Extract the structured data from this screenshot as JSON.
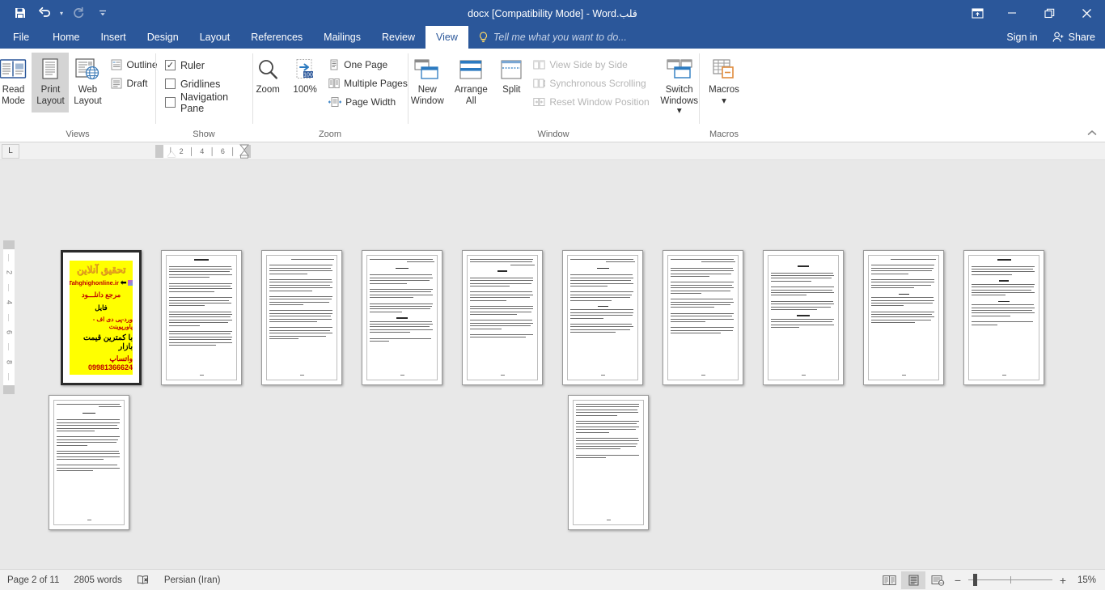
{
  "window": {
    "title": "قلب.docx [Compatibility Mode] - Word",
    "quick_access": [
      {
        "name": "save",
        "icon": "save-icon"
      },
      {
        "name": "undo",
        "icon": "undo-icon"
      },
      {
        "name": "redo",
        "icon": "redo-icon"
      },
      {
        "name": "customize-quick-access",
        "icon": "chevron-down-icon"
      }
    ],
    "controls": {
      "ribbon_display_options": "ribbon-display-options-icon",
      "minimize": "minimize-icon",
      "restore": "restore-icon",
      "close": "close-icon"
    }
  },
  "ribbon_tabs": [
    {
      "label": "File",
      "active": false
    },
    {
      "label": "Home",
      "active": false
    },
    {
      "label": "Insert",
      "active": false
    },
    {
      "label": "Design",
      "active": false
    },
    {
      "label": "Layout",
      "active": false
    },
    {
      "label": "References",
      "active": false
    },
    {
      "label": "Mailings",
      "active": false
    },
    {
      "label": "Review",
      "active": false
    },
    {
      "label": "View",
      "active": true
    }
  ],
  "tell_me": {
    "placeholder": "Tell me what you want to do..."
  },
  "account": {
    "sign_in": "Sign in",
    "share": "Share"
  },
  "ribbon": {
    "collapse_tooltip": "^",
    "groups": [
      {
        "label": "Views",
        "buttons": [
          {
            "label_line1": "Read",
            "label_line2": "Mode",
            "icon": "read-mode-icon",
            "selected": false
          },
          {
            "label_line1": "Print",
            "label_line2": "Layout",
            "icon": "print-layout-icon",
            "selected": true
          },
          {
            "label_line1": "Web",
            "label_line2": "Layout",
            "icon": "web-layout-icon",
            "selected": false
          }
        ],
        "small_buttons": [
          {
            "label": "Outline",
            "icon": "outline-icon"
          },
          {
            "label": "Draft",
            "icon": "draft-icon"
          }
        ]
      },
      {
        "label": "Show",
        "checkboxes": [
          {
            "label": "Ruler",
            "checked": true
          },
          {
            "label": "Gridlines",
            "checked": false
          },
          {
            "label": "Navigation Pane",
            "checked": false
          }
        ]
      },
      {
        "label": "Zoom",
        "buttons": [
          {
            "label_line1": "Zoom",
            "label_line2": "",
            "icon": "zoom-magnifier-icon",
            "selected": false
          },
          {
            "label_line1": "100%",
            "label_line2": "",
            "icon": "zoom-100-icon",
            "selected": false
          }
        ],
        "small_buttons": [
          {
            "label": "One Page",
            "icon": "one-page-icon"
          },
          {
            "label": "Multiple Pages",
            "icon": "multiple-pages-icon"
          },
          {
            "label": "Page Width",
            "icon": "page-width-icon"
          }
        ]
      },
      {
        "label": "Window",
        "buttons": [
          {
            "label_line1": "New",
            "label_line2": "Window",
            "icon": "new-window-icon",
            "selected": false
          },
          {
            "label_line1": "Arrange",
            "label_line2": "All",
            "icon": "arrange-all-icon",
            "selected": false
          },
          {
            "label_line1": "Split",
            "label_line2": "",
            "icon": "split-icon",
            "selected": false
          },
          {
            "label_line1": "Switch",
            "label_line2": "Windows ▾",
            "icon": "switch-windows-icon",
            "selected": false
          }
        ],
        "small_buttons": [
          {
            "label": "View Side by Side",
            "icon": "view-side-by-side-icon",
            "disabled": true
          },
          {
            "label": "Synchronous Scrolling",
            "icon": "synchronous-scrolling-icon",
            "disabled": true
          },
          {
            "label": "Reset Window Position",
            "icon": "reset-window-position-icon",
            "disabled": true
          }
        ]
      },
      {
        "label": "Macros",
        "buttons": [
          {
            "label_line1": "Macros",
            "label_line2": "▾",
            "icon": "macros-icon",
            "selected": false
          }
        ]
      }
    ]
  },
  "ruler": {
    "tab_stop_selector": "L",
    "horizontal_marks": "│ 6 │ 4 │ 2 │",
    "vertical_marks": [
      "2",
      "4",
      "6",
      "8"
    ]
  },
  "document": {
    "page_count": 11,
    "pages": [
      {
        "number": 1,
        "type": "advertisement",
        "selected": true
      },
      {
        "number": 2,
        "type": "text",
        "selected": false
      },
      {
        "number": 3,
        "type": "text",
        "selected": false
      },
      {
        "number": 4,
        "type": "text",
        "selected": false
      },
      {
        "number": 5,
        "type": "text",
        "selected": false
      },
      {
        "number": 6,
        "type": "text",
        "selected": false
      },
      {
        "number": 7,
        "type": "text",
        "selected": false
      },
      {
        "number": 8,
        "type": "text",
        "selected": false
      },
      {
        "number": 9,
        "type": "text",
        "selected": false
      },
      {
        "number": 10,
        "type": "text",
        "selected": false
      },
      {
        "number": 11,
        "type": "text-partial",
        "selected": false
      }
    ],
    "advertisement": {
      "line1": "تحقیق آنلاین",
      "line2": "Tahghighonline.ir",
      "line3": "مرجع دانلـــود",
      "line4": "فایل",
      "line5": "ورد-پی دی اف - پاورپوینت",
      "line6": "با کمترین قیمت بازار",
      "line7": "واتساپ 09981366624"
    }
  },
  "status_bar": {
    "page_indicator": "Page 2 of 11",
    "word_count": "2805 words",
    "proofing_icon": "proofing-errors-icon",
    "language": "Persian (Iran)",
    "view_buttons": [
      {
        "name": "read-mode-view",
        "icon": "read-mode-view-icon",
        "active": false
      },
      {
        "name": "print-layout-view",
        "icon": "print-layout-view-icon",
        "active": true
      },
      {
        "name": "web-layout-view",
        "icon": "web-layout-view-icon",
        "active": false
      }
    ],
    "zoom": {
      "minus": "−",
      "plus": "+",
      "level": "15%"
    }
  }
}
